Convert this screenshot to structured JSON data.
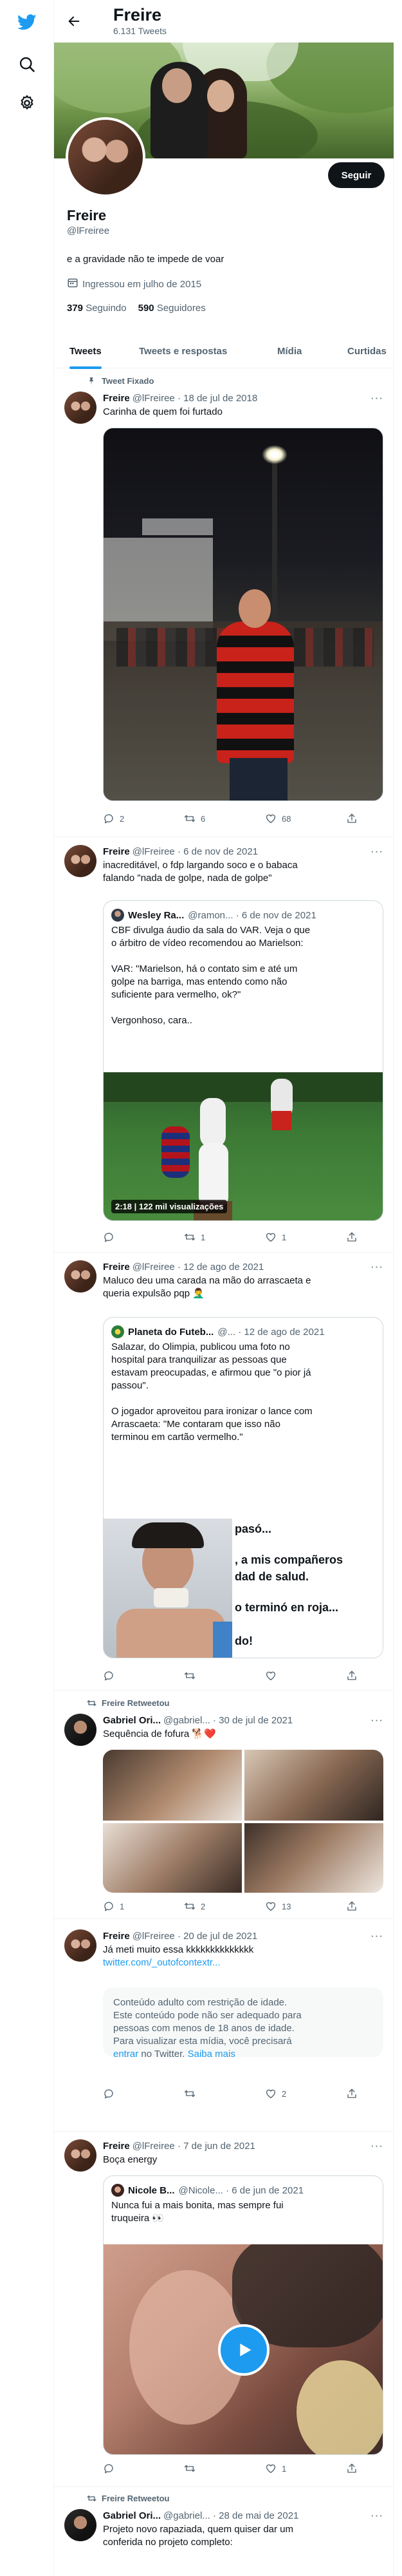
{
  "header": {
    "name": "Freire",
    "tweet_count": "6.131 Tweets"
  },
  "profile": {
    "name": "Freire",
    "handle": "@lFreiree",
    "bio": "e a gravidade não te impede de voar",
    "joined": "Ingressou em julho de 2015",
    "following_count": "379",
    "following_label": "Seguindo",
    "followers_count": "590",
    "followers_label": "Seguidores",
    "follow_label": "Seguir"
  },
  "tabs": [
    "Tweets",
    "Tweets e respostas",
    "Mídia",
    "Curtidas"
  ],
  "colors": {
    "accent": "#1d9bf0",
    "text": "#0f1419",
    "muted": "#536471",
    "like_pink": "#f91880"
  },
  "icons": {
    "logo": "twitter-bird-icon",
    "search": "search-icon",
    "settings": "gear-icon",
    "back": "arrow-left-icon",
    "pin": "pin-icon",
    "retweet": "retweet-icon"
  },
  "tweets": [
    {
      "context": "Tweet Fixado",
      "name": "Freire",
      "meta": "@lFreiree · 18 de jul de 2018",
      "text": "Carinha de quem foi furtado",
      "reply": "2",
      "retweet": "6",
      "like": "68"
    },
    {
      "name": "Freire",
      "meta": "@lFreiree · 6 de nov de 2021",
      "text": "inacreditável, o fdp largando soco e o babaca\nfalando \"nada de golpe, nada de golpe\"",
      "quote": {
        "name": "Wesley Ra...",
        "meta": "@ramon... · 6 de nov de 2021",
        "text": "CBF divulga áudio da sala do VAR. Veja o que\no árbitro de vídeo recomendou ao Marielson:\n\nVAR: \"Marielson, há o contato sim e até um\ngolpe na barriga, mas entendo como não\nsuficiente para vermelho, ok?\"\n\nVergonhoso, cara..",
        "video_caption": "2:18 | 122 mil visualizações"
      },
      "reply": "",
      "retweet": "1",
      "like": "1"
    },
    {
      "name": "Freire",
      "meta": "@lFreiree · 12 de ago de 2021",
      "text": "Maluco deu uma carada na mão do arrascaeta e\nqueria expulsão pqp 🤦‍♂️",
      "quote": {
        "name": "Planeta do Futeb...",
        "meta": "@... · 12 de ago de 2021",
        "text": "Salazar, do Olimpia, publicou uma foto no\nhospital para tranquilizar as pessoas que\nestavam preocupadas, e afirmou que \"o pior já\npassou\".\n\nO jogador aproveitou para ironizar o lance com\nArrascaeta: \"Me contaram que isso não\nterminou em cartão vermelho.\"",
        "img_lines": [
          "pasó...",
          ", a mis compañeros",
          "dad de salud.",
          "o terminó en roja...",
          "do!"
        ]
      },
      "reply": "",
      "retweet": "",
      "like": ""
    },
    {
      "context": "Freire Retweetou",
      "name": "Gabriel Ori...",
      "meta": "@gabriel... · 30 de jul de 2021",
      "text": "Sequência de fofura 🐕❤️",
      "reply": "1",
      "retweet": "2",
      "like": "13"
    },
    {
      "name": "Freire",
      "meta": "@lFreiree · 20 de jul de 2021",
      "text": "Já meti muito essa kkkkkkkkkkkkkk",
      "link": "twitter.com/_outofcontextr...",
      "age_notice": "Conteúdo adulto com restrição de idade.\nEste conteúdo pode não ser adequado para\npessoas com menos de 18 anos de idade.\nPara visualizar esta mídia, você precisará",
      "age_login": "entrar",
      "age_tail": " no Twitter. ",
      "age_more": "Saiba mais",
      "reply": "",
      "retweet": "",
      "like": "2"
    },
    {
      "name": "Freire",
      "meta": "@lFreiree · 7 de jun de 2021",
      "text": "Boça energy",
      "quote": {
        "name": "Nicole B...",
        "meta": "@Nicole... · 6 de jun de 2021",
        "text": "Nunca fui a mais bonita, mas sempre fui\ntruqueira 👀"
      },
      "reply": "",
      "retweet": "",
      "like": "1"
    },
    {
      "context": "Freire Retweetou",
      "name": "Gabriel Ori...",
      "meta": "@gabriel... · 28 de mai de 2021",
      "text": "Projeto novo rapaziada, quem quiser dar um\nconferida no projeto completo:"
    }
  ]
}
